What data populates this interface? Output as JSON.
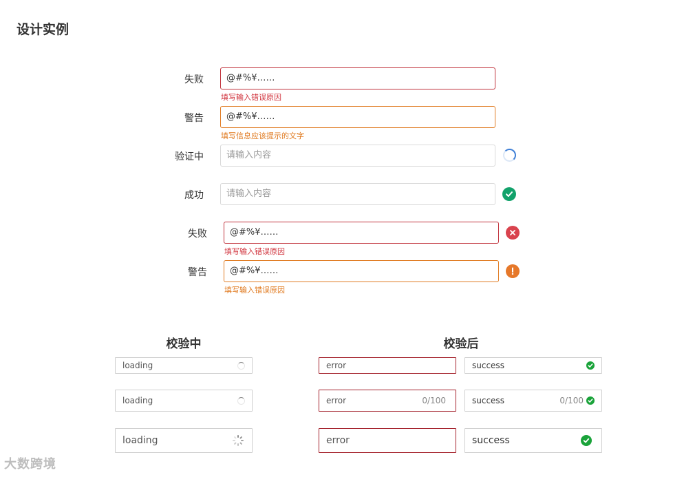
{
  "page_title": "设计实例",
  "form_rows": [
    {
      "label": "失败",
      "value": "@#%¥……",
      "help": "填写输入错误原因"
    },
    {
      "label": "警告",
      "value": "@#%¥……",
      "help": "填写信息应该提示的文字"
    },
    {
      "label": "验证中",
      "placeholder": "请输入内容"
    },
    {
      "label": "成功",
      "placeholder": "请输入内容"
    },
    {
      "label": "失败",
      "value": "@#%¥……",
      "help": "填写输入错误原因"
    },
    {
      "label": "警告",
      "value": "@#%¥……",
      "help": "填写输入错误原因"
    }
  ],
  "validating": {
    "title": "校验中",
    "small": "loading",
    "medium": "loading",
    "large": "loading"
  },
  "validated": {
    "title": "校验后",
    "error_small": "error",
    "error_medium": "error",
    "error_medium_count": "0/100",
    "error_large": "error",
    "success_small": "success",
    "success_medium": "success",
    "success_medium_count": "0/100",
    "success_large": "success"
  },
  "watermark": "大数跨境",
  "colors": {
    "error": "#c0303a",
    "warning": "#e07a20",
    "success": "#12a26b",
    "loading": "#3e7fd6",
    "success_check": "#1aa33a"
  },
  "icons": [
    "loading-spinner-icon",
    "success-check-icon",
    "error-close-icon",
    "warning-exclamation-icon"
  ]
}
